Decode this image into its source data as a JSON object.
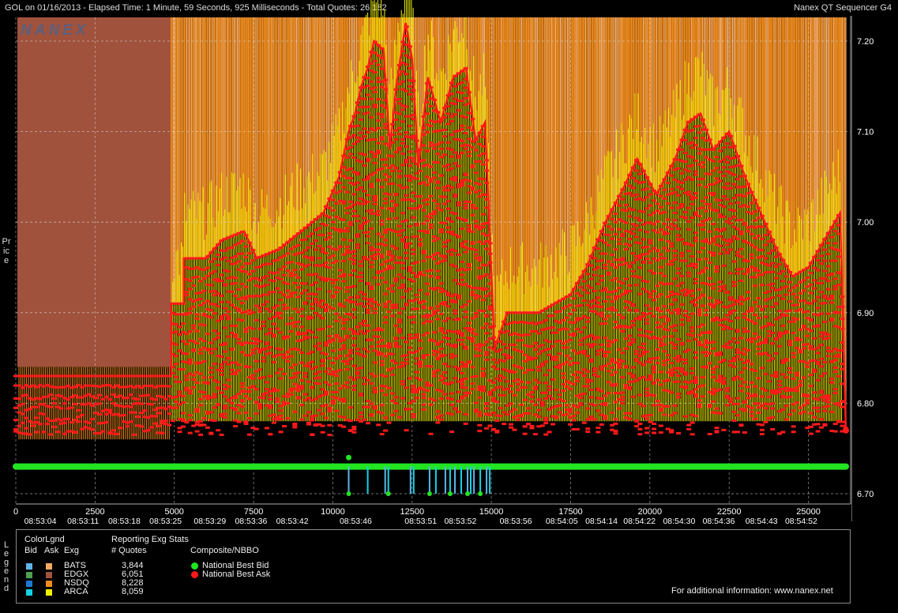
{
  "header": {
    "title": "GOL on 01/16/2013  -  Elapsed Time: 1 Minute, 59 Seconds, 925 Milliseconds  -  Total Quotes: 26,182",
    "app_name": "Nanex QT Sequencer G4",
    "watermark": "NANEX"
  },
  "axis": {
    "ylabel": "Price",
    "legend_side_label": "Legend"
  },
  "chart_data": {
    "type": "line",
    "ylim": [
      6.7,
      7.22
    ],
    "yticks": [
      "7.20",
      "7.10",
      "7.00",
      "6.90",
      "6.80",
      "6.70"
    ],
    "ytick_values": [
      7.2,
      7.1,
      7.0,
      6.9,
      6.8,
      6.7
    ],
    "xlim": [
      0,
      26182
    ],
    "xticks": [
      "0",
      "2500",
      "5000",
      "7500",
      "10000",
      "12500",
      "15000",
      "17500",
      "20000",
      "22500",
      "25000"
    ],
    "xtick_values": [
      0,
      2500,
      5000,
      7500,
      10000,
      12500,
      15000,
      17500,
      20000,
      22500,
      25000
    ],
    "time_labels": [
      "08:53:04",
      "08:53:11",
      "08:53:18",
      "08:53:25",
      "08:53:29",
      "08:53:36",
      "08:53:42",
      "08:53:46",
      "08:53:51",
      "08:53:52",
      "08:53:56",
      "08:54:05",
      "08:54:14",
      "08:54:22",
      "08:54:30",
      "08:54:36",
      "08:54:43",
      "08:54:52"
    ],
    "time_label_values": [
      0,
      1350,
      2650,
      3950,
      5350,
      6650,
      7950,
      9950,
      12000,
      13250,
      15000,
      16450,
      17700,
      18900,
      20150,
      21400,
      22750,
      24000
    ],
    "grid": true,
    "series": [
      {
        "name": "National Best Bid",
        "points": [
          [
            0,
            6.73
          ],
          [
            26182,
            6.73
          ]
        ]
      },
      {
        "name": "National Best Ask",
        "points": [
          [
            0,
            6.83
          ],
          [
            4900,
            6.83
          ],
          [
            4900,
            6.91
          ],
          [
            5300,
            6.91
          ],
          [
            5300,
            6.96
          ],
          [
            6000,
            6.96
          ],
          [
            6500,
            6.98
          ],
          [
            7200,
            6.99
          ],
          [
            7600,
            6.96
          ],
          [
            8300,
            6.97
          ],
          [
            9000,
            6.99
          ],
          [
            9700,
            7.01
          ],
          [
            10200,
            7.05
          ],
          [
            10500,
            7.1
          ],
          [
            10700,
            7.12
          ],
          [
            10900,
            7.15
          ],
          [
            11100,
            7.17
          ],
          [
            11300,
            7.2
          ],
          [
            11600,
            7.19
          ],
          [
            11800,
            7.08
          ],
          [
            12000,
            7.15
          ],
          [
            12300,
            7.22
          ],
          [
            12500,
            7.18
          ],
          [
            12700,
            7.06
          ],
          [
            13000,
            7.16
          ],
          [
            13400,
            7.11
          ],
          [
            13800,
            7.16
          ],
          [
            14200,
            7.17
          ],
          [
            14500,
            7.09
          ],
          [
            14800,
            7.11
          ],
          [
            15100,
            6.86
          ],
          [
            15500,
            6.9
          ],
          [
            16500,
            6.9
          ],
          [
            17500,
            6.92
          ],
          [
            18000,
            6.95
          ],
          [
            18600,
            7.0
          ],
          [
            19200,
            7.04
          ],
          [
            19600,
            7.07
          ],
          [
            20200,
            7.03
          ],
          [
            20800,
            7.07
          ],
          [
            21200,
            7.11
          ],
          [
            21600,
            7.12
          ],
          [
            22000,
            7.08
          ],
          [
            22500,
            7.1
          ],
          [
            23000,
            7.05
          ],
          [
            23500,
            7.01
          ],
          [
            24000,
            6.97
          ],
          [
            24500,
            6.94
          ],
          [
            25000,
            6.95
          ],
          [
            25500,
            6.98
          ],
          [
            26000,
            7.01
          ],
          [
            26182,
            6.77
          ]
        ]
      },
      {
        "name": "BATS",
        "values": [
          3844
        ]
      },
      {
        "name": "EDGX",
        "values": [
          6051
        ]
      },
      {
        "name": "NSDQ",
        "values": [
          8228
        ]
      },
      {
        "name": "ARCA",
        "values": [
          8059
        ]
      }
    ],
    "spike_positions": [
      10500,
      11100,
      11650,
      11750,
      12450,
      12550,
      13050,
      13250,
      13550,
      13700,
      13850,
      14050,
      14250,
      14350,
      14450,
      14650,
      14850,
      14950
    ]
  },
  "legend": {
    "colorlegend_title": "ColorLgnd",
    "col_bid": "Bid",
    "col_ask": "Ask",
    "col_exg": "Exg",
    "stats_title": "Reporting Exg Stats",
    "stats_sub": "# Quotes",
    "composite_title": "Composite/NBBO",
    "exchanges": [
      {
        "name": "BATS",
        "count": "3,844",
        "bid_color": "#5fb4e8",
        "ask_color": "#f4a860"
      },
      {
        "name": "EDGX",
        "count": "6,051",
        "bid_color": "#4fa04f",
        "ask_color": "#a0523c"
      },
      {
        "name": "NSDQ",
        "count": "8,228",
        "bid_color": "#1e78d2",
        "ask_color": "#f08c1e"
      },
      {
        "name": "ARCA",
        "count": "8,059",
        "bid_color": "#14d2e6",
        "ask_color": "#f0f000"
      }
    ],
    "nbbo": [
      {
        "label": "National Best Bid",
        "color": "#22e522"
      },
      {
        "label": "National Best Ask",
        "color": "#ff1a1a"
      }
    ],
    "footer": "For additional information: www.nanex.net"
  }
}
